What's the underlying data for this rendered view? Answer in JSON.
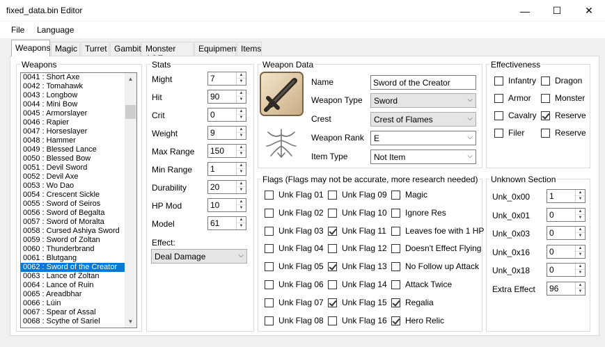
{
  "window": {
    "title": "fixed_data.bin Editor",
    "minimize": "—",
    "maximize": "☐",
    "close": "✕"
  },
  "menu": [
    "File",
    "Language"
  ],
  "tabs": [
    "Weapons",
    "Magic",
    "Turret",
    "Gambit",
    "Monster AOE",
    "Equipment",
    "Items"
  ],
  "weapons_group": {
    "title": "Weapons",
    "items": [
      "0041 : Short Axe",
      "0042 : Tomahawk",
      "0043 : Longbow",
      "0044 : Mini Bow",
      "0045 : Armorslayer",
      "0046 : Rapier",
      "0047 : Horseslayer",
      "0048 : Hammer",
      "0049 : Blessed Lance",
      "0050 : Blessed Bow",
      "0051 : Devil Sword",
      "0052 : Devil Axe",
      "0053 : Wo Dao",
      "0054 : Crescent Sickle",
      "0055 : Sword of Seiros",
      "0056 : Sword of Begalta",
      "0057 : Sword of Moralta",
      "0058 : Cursed Ashiya Sword",
      "0059 : Sword of Zoltan",
      "0060 : Thunderbrand",
      "0061 : Blutgang",
      "0062 : Sword of the Creator",
      "0063 : Lance of Zoltan",
      "0064 : Lance of Ruin",
      "0065 : Areadbhar",
      "0066 : Lúin",
      "0067 : Spear of Assal",
      "0068 : Scythe of Sariel"
    ],
    "selected_index": 21,
    "scroll_up": "▲",
    "scroll_down": "▼"
  },
  "stats": {
    "title": "Stats",
    "fields": [
      {
        "label": "Might",
        "value": "7"
      },
      {
        "label": "Hit",
        "value": "90"
      },
      {
        "label": "Crit",
        "value": "0"
      },
      {
        "label": "Weight",
        "value": "9"
      },
      {
        "label": "Max Range",
        "value": "150"
      },
      {
        "label": "Min Range",
        "value": "1"
      },
      {
        "label": "Durability",
        "value": "20"
      },
      {
        "label": "HP Mod",
        "value": "10"
      },
      {
        "label": "Model",
        "value": "61"
      }
    ],
    "effect_label": "Effect:",
    "effect_value": "Deal Damage"
  },
  "weapon_data": {
    "title": "Weapon Data",
    "name_label": "Name",
    "name_value": "Sword of the Creator",
    "type_label": "Weapon Type",
    "type_value": "Sword",
    "crest_label": "Crest",
    "crest_value": "Crest of Flames",
    "rank_label": "Weapon Rank",
    "rank_value": "E",
    "item_type_label": "Item Type",
    "item_type_value": "Not Item",
    "icon": "sword-icon",
    "crest_icon": "crest-of-flames-icon"
  },
  "effectiveness": {
    "title": "Effectiveness",
    "items": [
      {
        "label": "Infantry",
        "checked": false
      },
      {
        "label": "Dragon",
        "checked": false
      },
      {
        "label": "Armor",
        "checked": false
      },
      {
        "label": "Monster",
        "checked": false
      },
      {
        "label": "Cavalry",
        "checked": false
      },
      {
        "label": "Reserve",
        "checked": true
      },
      {
        "label": "Filer",
        "checked": false
      },
      {
        "label": "Reserve",
        "checked": false
      }
    ]
  },
  "flags": {
    "title": "Flags (Flags may not be accurate, more research needed)",
    "col1": [
      {
        "label": "Unk Flag 01",
        "checked": false
      },
      {
        "label": "Unk Flag 02",
        "checked": false
      },
      {
        "label": "Unk Flag 03",
        "checked": false
      },
      {
        "label": "Unk Flag 04",
        "checked": false
      },
      {
        "label": "Unk Flag 05",
        "checked": false
      },
      {
        "label": "Unk Flag 06",
        "checked": false
      },
      {
        "label": "Unk Flag 07",
        "checked": false
      },
      {
        "label": "Unk Flag 08",
        "checked": false
      }
    ],
    "col2": [
      {
        "label": "Unk Flag 09",
        "checked": false
      },
      {
        "label": "Unk Flag 10",
        "checked": false
      },
      {
        "label": "Unk Flag 11",
        "checked": true
      },
      {
        "label": "Unk Flag 12",
        "checked": false
      },
      {
        "label": "Unk Flag 13",
        "checked": true
      },
      {
        "label": "Unk Flag 14",
        "checked": false
      },
      {
        "label": "Unk Flag 15",
        "checked": true
      },
      {
        "label": "Unk Flag 16",
        "checked": false
      }
    ],
    "col3": [
      {
        "label": "Magic",
        "checked": false
      },
      {
        "label": "Ignore Res",
        "checked": false
      },
      {
        "label": "Leaves foe with 1 HP",
        "checked": false
      },
      {
        "label": "Doesn't Effect Flying",
        "checked": false
      },
      {
        "label": "No Follow up Attack",
        "checked": false
      },
      {
        "label": "Attack Twice",
        "checked": false
      },
      {
        "label": "Regalia",
        "checked": true
      },
      {
        "label": "Hero Relic",
        "checked": true
      }
    ]
  },
  "unknown": {
    "title": "Unknown Section",
    "fields": [
      {
        "label": "Unk_0x00",
        "value": "1"
      },
      {
        "label": "Unk_0x01",
        "value": "0"
      },
      {
        "label": "Unk_0x03",
        "value": "0"
      },
      {
        "label": "Unk_0x16",
        "value": "0"
      },
      {
        "label": "Unk_0x18",
        "value": "0"
      },
      {
        "label": "Extra Effect",
        "value": "96"
      }
    ]
  },
  "colors": {
    "selection": "#0078d7",
    "window_bg": "#f0f0f0",
    "panel_bg": "#ffffff"
  }
}
